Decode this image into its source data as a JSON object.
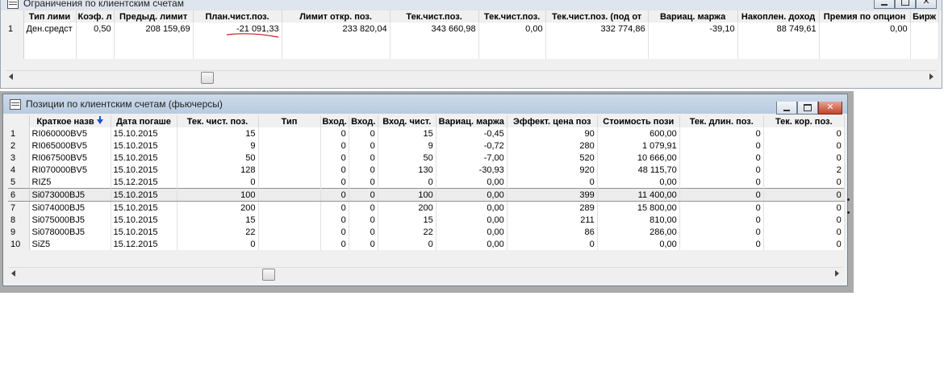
{
  "windows": {
    "limits": {
      "title": "Ограничения по клиентским счетам",
      "columns": [
        "",
        "Тип лими",
        "Коэф. л",
        "Предыд. лимит",
        "План.чист.поз.",
        "Лимит откр. поз.",
        "Тек.чист.поз.",
        "Тек.чист.поз.",
        "Тек.чист.поз. (под от",
        "Вариац. маржа",
        "Накоплен. доход",
        "Премия по опцион",
        "Бирж"
      ],
      "rows": [
        [
          "1",
          "Ден.средст",
          "0,50",
          "208 159,69",
          "-21 091,33",
          "233 820,04",
          "343 660,98",
          "0,00",
          "332 774,86",
          "-39,10",
          "88 749,61",
          "0,00",
          ""
        ]
      ]
    },
    "positions": {
      "title": "Позиции по клиентским счетам (фьючерсы)",
      "columns": [
        "",
        "Краткое назв",
        "Дата погаше",
        "Тек. чист. поз.",
        "Тип",
        "Вход.",
        "Вход.",
        "Вход. чист.",
        "Вариац. маржа",
        "Эффект. цена поз",
        "Стоимость пози",
        "Тек. длин. поз.",
        "Тек. кор. поз."
      ],
      "rows": [
        [
          "1",
          "RI060000BV5",
          "15.10.2015",
          "15",
          "",
          "0",
          "0",
          "15",
          "-0,45",
          "90",
          "600,00",
          "0",
          "0"
        ],
        [
          "2",
          "RI065000BV5",
          "15.10.2015",
          "9",
          "",
          "0",
          "0",
          "9",
          "-0,72",
          "280",
          "1 079,91",
          "0",
          "0"
        ],
        [
          "3",
          "RI067500BV5",
          "15.10.2015",
          "50",
          "",
          "0",
          "0",
          "50",
          "-7,00",
          "520",
          "10 666,00",
          "0",
          "0"
        ],
        [
          "4",
          "RI070000BV5",
          "15.10.2015",
          "128",
          "",
          "0",
          "0",
          "130",
          "-30,93",
          "920",
          "48 115,70",
          "0",
          "2"
        ],
        [
          "5",
          "RIZ5",
          "15.12.2015",
          "0",
          "",
          "0",
          "0",
          "0",
          "0,00",
          "0",
          "0,00",
          "0",
          "0"
        ],
        [
          "6",
          "Si073000BJ5",
          "15.10.2015",
          "100",
          "",
          "0",
          "0",
          "100",
          "0,00",
          "399",
          "11 400,00",
          "0",
          "0"
        ],
        [
          "7",
          "Si074000BJ5",
          "15.10.2015",
          "200",
          "",
          "0",
          "0",
          "200",
          "0,00",
          "289",
          "15 800,00",
          "0",
          "0"
        ],
        [
          "8",
          "Si075000BJ5",
          "15.10.2015",
          "15",
          "",
          "0",
          "0",
          "15",
          "0,00",
          "211",
          "810,00",
          "0",
          "0"
        ],
        [
          "9",
          "Si078000BJ5",
          "15.10.2015",
          "22",
          "",
          "0",
          "0",
          "22",
          "0,00",
          "86",
          "286,00",
          "0",
          "0"
        ],
        [
          "10",
          "SiZ5",
          "15.12.2015",
          "0",
          "",
          "0",
          "0",
          "0",
          "0,00",
          "0",
          "0,00",
          "0",
          "0"
        ]
      ],
      "selected_row": 5,
      "sort_icon": "sort-descending-icon"
    }
  },
  "colors": {
    "annotation_red": "#c8191e",
    "sort_arrow": "#1a4fd6",
    "close_button": "#c2432c"
  }
}
